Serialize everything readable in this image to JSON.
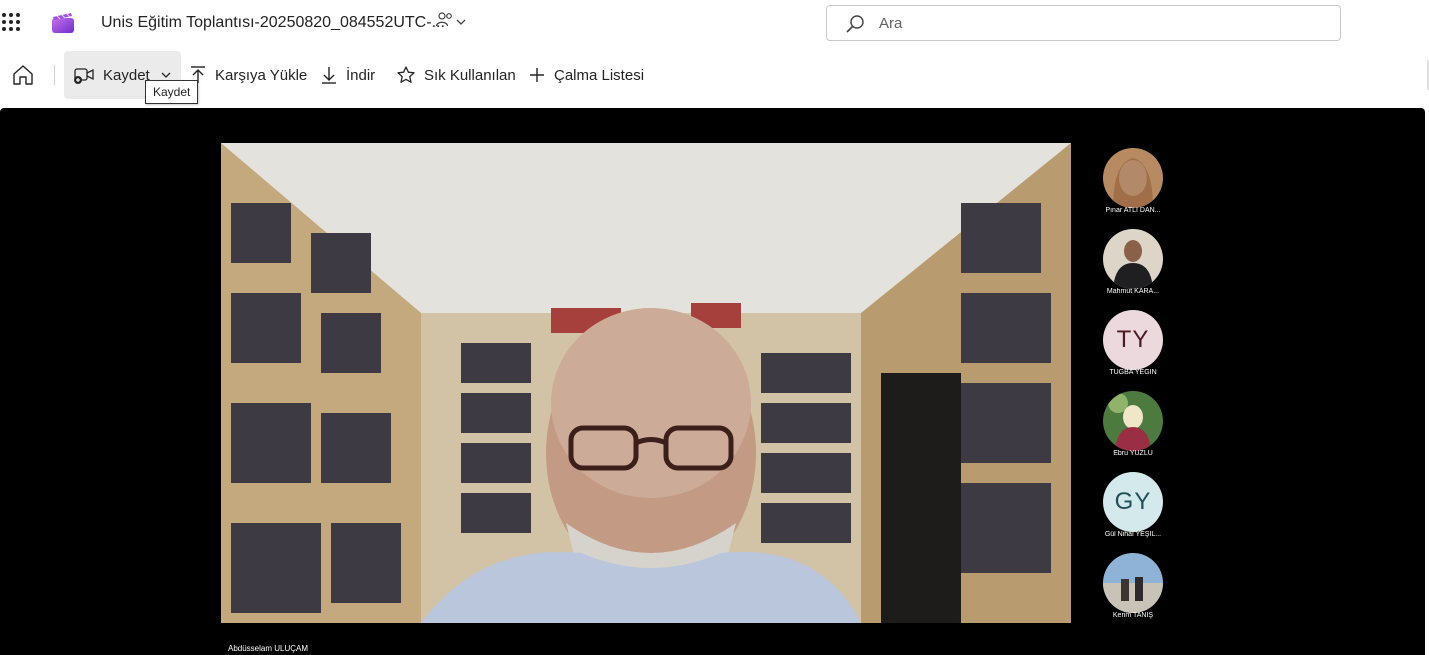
{
  "header": {
    "title": "Unis Eğitim Toplantısı-20250820_084552UTC-...",
    "search_placeholder": "Ara"
  },
  "toolbar": {
    "save_label": "Kaydet",
    "upload_label": "Karşıya Yükle",
    "download_label": "İndir",
    "favorites_label": "Sık Kullanılan",
    "playlist_label": "Çalma Listesi",
    "tooltip": "Kaydet"
  },
  "video": {
    "speaker_name": "Abdüsselam ULUÇAM",
    "participants": [
      {
        "name": "Pınar ATLI DAN...",
        "type": "photo"
      },
      {
        "name": "Mahmut KARA...",
        "type": "photo"
      },
      {
        "name": "TUĞBA YEGİN",
        "initials": "TY",
        "type": "initials",
        "bg": "#ecd9dd",
        "fg": "#4a1a24"
      },
      {
        "name": "Ebru YÜZLÜ",
        "type": "photo"
      },
      {
        "name": "Gül Nihal YEŞİL...",
        "initials": "GY",
        "type": "initials",
        "bg": "#d4e9ec",
        "fg": "#1f4f57"
      },
      {
        "name": "Kerim TANIŞ",
        "type": "photo"
      }
    ]
  },
  "colors": {
    "accent": "#7b3fbf",
    "player_bg": "#000000"
  },
  "icons": [
    "app-launcher-icon",
    "stream-logo-icon",
    "share-people-icon",
    "search-icon",
    "home-icon",
    "record-video-icon",
    "chevron-down-icon",
    "upload-icon",
    "download-icon",
    "star-icon",
    "plus-icon"
  ]
}
